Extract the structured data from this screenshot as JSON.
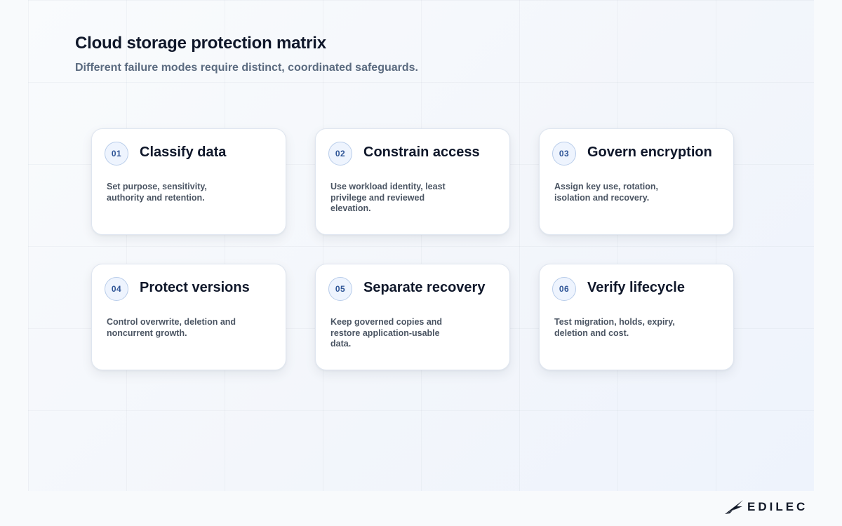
{
  "header": {
    "title": "Cloud storage protection matrix",
    "subtitle": "Different failure modes require distinct, coordinated safeguards."
  },
  "cards": [
    {
      "number": "01",
      "title": "Classify data",
      "body": "Set purpose, sensitivity, authority and retention."
    },
    {
      "number": "02",
      "title": "Constrain access",
      "body": "Use workload identity, least privilege and reviewed elevation."
    },
    {
      "number": "03",
      "title": "Govern encryption",
      "body": "Assign key use, rotation, isolation and recovery."
    },
    {
      "number": "04",
      "title": "Protect versions",
      "body": "Control overwrite, deletion and noncurrent growth."
    },
    {
      "number": "05",
      "title": "Separate recovery",
      "body": "Keep governed copies and restore application-usable data."
    },
    {
      "number": "06",
      "title": "Verify lifecycle",
      "body": "Test migration, holds, expiry, deletion and cost."
    }
  ],
  "brand": {
    "name": "EDILEC",
    "icon": "edilec-wing-logo-icon"
  },
  "colors": {
    "title": "#0f172a",
    "subtitle": "#5b6b80",
    "badge_text": "#2f5597",
    "badge_border": "#b9cdea",
    "badge_fill": "#eef4fe",
    "card_border": "#dfe6f0",
    "body_text": "#4b5563"
  }
}
